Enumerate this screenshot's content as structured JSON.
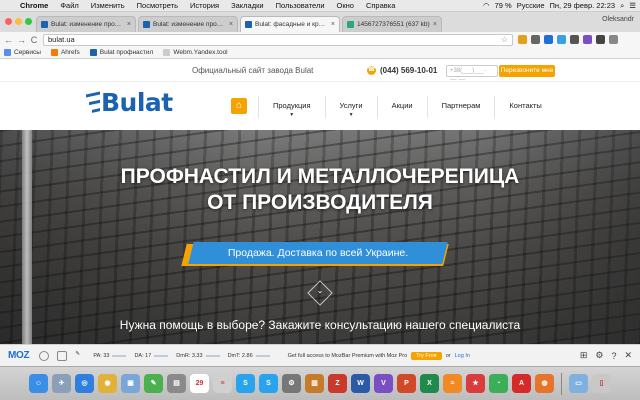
{
  "menubar": {
    "apple_glyph": "",
    "items": [
      "Chrome",
      "Файл",
      "Изменить",
      "Посмотреть",
      "История",
      "Закладки",
      "Пользователи",
      "Окно",
      "Справка"
    ],
    "battery": "79 %",
    "lang": "Русские",
    "datetime": "Пн, 29 февр.  22:23"
  },
  "tabs": [
    {
      "title": "Bulat: изменение продукта",
      "color": "#1a63b0",
      "active": false
    },
    {
      "title": "Bulat: изменение продукта",
      "color": "#1a63b0",
      "active": false
    },
    {
      "title": "Bulat: фасадные и кровельные",
      "color": "#1a63b0",
      "active": true
    },
    {
      "title": "1456727376551 (637 kb)",
      "color": "#2aa77b",
      "active": false
    }
  ],
  "tab_close": "×",
  "window_user": "Oleksandr",
  "addressbar": {
    "back": "←",
    "forward": "→",
    "reload": "C",
    "url": "bulat.ua",
    "star": "☆"
  },
  "bookmarks": [
    {
      "label": "Сервисы",
      "color": "#5b8def"
    },
    {
      "label": "Ahrefs",
      "color": "#f57c00"
    },
    {
      "label": "Bulat профнастил",
      "color": "#1a63b0"
    },
    {
      "label": "Webm.Yandex.tool",
      "color": "#cccccc"
    }
  ],
  "site": {
    "official_text": "Официальный сайт завода Bulat",
    "phone": "(044) 569-10-01",
    "phone_placeholder": "+38(___)___-__-__",
    "callback_button": "Перезвоните мне",
    "logo_text": "Bulat",
    "home_icon": "⌂",
    "nav": [
      {
        "label": "Продукция",
        "caret": "▼"
      },
      {
        "label": "Услуги",
        "caret": "▼"
      },
      {
        "label": "Акции",
        "caret": ""
      },
      {
        "label": "Партнерам",
        "caret": ""
      },
      {
        "label": "Контакты",
        "caret": ""
      }
    ],
    "hero_line1": "ПРОФНАСТИЛ И МЕТАЛЛОЧЕРЕПИЦА",
    "hero_line2": "ОТ ПРОИЗВОДИТЕЛЯ",
    "ribbon": "Продажа. Доставка по всей Украине.",
    "scroll_glyph": "⌄",
    "help_text": "Нужна помощь в выборе? Закажите консультацию нашего специалиста"
  },
  "mozbar": {
    "logo": "MOZ",
    "metrics": [
      {
        "label": "PA: 33"
      },
      {
        "label": "DA: 17"
      },
      {
        "label": "DmR: 3.33"
      },
      {
        "label": "DmT: 2.86"
      }
    ],
    "promo": "Get full access to MozBar Premium with Moz Pro",
    "try": "Try Free",
    "or": "or",
    "login": "Log In",
    "right_icons": [
      "⊞",
      "⚙",
      "?",
      "✕"
    ]
  },
  "dock": [
    {
      "name": "finder",
      "color": "#3a8ee6",
      "glyph": "☺"
    },
    {
      "name": "launchpad",
      "color": "#8aa0b8",
      "glyph": "✈"
    },
    {
      "name": "safari",
      "color": "#2f7fe0",
      "glyph": "◎"
    },
    {
      "name": "chrome",
      "color": "#e0b23a",
      "glyph": "◉"
    },
    {
      "name": "photos",
      "color": "#7aa6d8",
      "glyph": "▣"
    },
    {
      "name": "evernote",
      "color": "#4caf50",
      "glyph": "✎"
    },
    {
      "name": "notes",
      "color": "#8a8a8a",
      "glyph": "▤"
    },
    {
      "name": "calendar",
      "color": "#ffffff",
      "glyph": "29"
    },
    {
      "name": "reminders",
      "color": "#d0d0d0",
      "glyph": "≡"
    },
    {
      "name": "skype",
      "color": "#2aa3ee",
      "glyph": "S"
    },
    {
      "name": "skype-2",
      "color": "#2aa3ee",
      "glyph": "S"
    },
    {
      "name": "system-prefs",
      "color": "#777777",
      "glyph": "⚙"
    },
    {
      "name": "transmit",
      "color": "#c57b2a",
      "glyph": "▥"
    },
    {
      "name": "filezilla",
      "color": "#c93a2a",
      "glyph": "Z"
    },
    {
      "name": "word",
      "color": "#2b5aa6",
      "glyph": "W"
    },
    {
      "name": "viber",
      "color": "#7b4fc4",
      "glyph": "V"
    },
    {
      "name": "powerpoint",
      "color": "#d04a2a",
      "glyph": "P"
    },
    {
      "name": "excel",
      "color": "#1f8a4b",
      "glyph": "X"
    },
    {
      "name": "rss",
      "color": "#f08a24",
      "glyph": "≈"
    },
    {
      "name": "wunderlist",
      "color": "#d83c3c",
      "glyph": "★"
    },
    {
      "name": "maps",
      "color": "#3cae5a",
      "glyph": "◔"
    },
    {
      "name": "acrobat",
      "color": "#d42a2a",
      "glyph": "A"
    },
    {
      "name": "firefox",
      "color": "#e6742a",
      "glyph": "◍"
    },
    {
      "name": "downloads",
      "color": "#7fb0e0",
      "glyph": "▭"
    },
    {
      "name": "trash",
      "color": "#c8c8c8",
      "glyph": "▯"
    }
  ]
}
